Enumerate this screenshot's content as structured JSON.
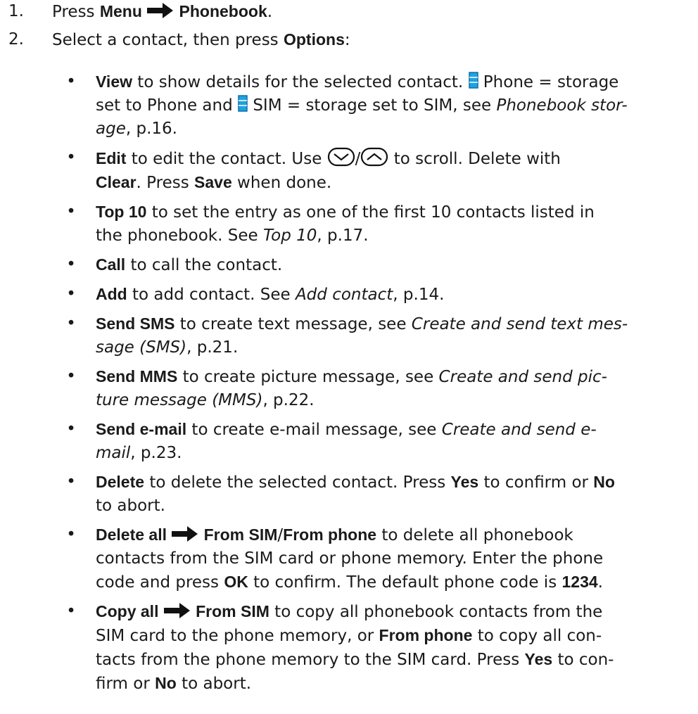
{
  "steps": [
    {
      "num": "1.",
      "t1": "Press ",
      "b1": "Menu",
      "b2": "Phonebook",
      "t2": "."
    },
    {
      "num": "2.",
      "t1": "Select a contact, then press ",
      "b1": "Options",
      "t2": ":"
    }
  ],
  "bullet_glyph": "•",
  "items": {
    "view": {
      "b1": "View",
      "t1": " to show details for the selected contact. ",
      "t2": " Phone = storage",
      "t3": "set to Phone and ",
      "t4": " SIM = storage set to SIM, see ",
      "i1": "Phonebook stor-",
      "i2": "age",
      "t5": ", p.16."
    },
    "edit": {
      "b1": "Edit",
      "t1": " to edit the contact. Use ",
      "t2": "/",
      "t3": " to scroll. Delete with",
      "b2": "Clear",
      "t4": ". Press ",
      "b3": "Save",
      "t5": " when done."
    },
    "top10": {
      "b1": "Top 10",
      "t1": " to set the entry as one of the first 10 contacts listed in",
      "t2": "the phonebook. See ",
      "i1": "Top 10",
      "t3": ", p.17."
    },
    "call": {
      "b1": "Call",
      "t1": " to call the contact."
    },
    "add": {
      "b1": "Add",
      "t1": " to add contact. See ",
      "i1": "Add contact",
      "t2": ", p.14."
    },
    "sms": {
      "b1": "Send SMS",
      "t1": " to create text message, see ",
      "i1": "Create and send text mes-",
      "i2": "sage (SMS)",
      "t2": ", p.21."
    },
    "mms": {
      "b1": "Send MMS",
      "t1": " to create picture message, see ",
      "i1": "Create and send pic-",
      "i2": "ture message (MMS)",
      "t2": ", p.22."
    },
    "email": {
      "b1": "Send e-mail",
      "t1": " to create e-mail message, see ",
      "i1": "Create and send e-",
      "i2": "mail",
      "t2": ", p.23."
    },
    "delete": {
      "b1": "Delete",
      "t1": " to delete the selected contact. Press ",
      "b2": "Yes",
      "t2": " to confirm or ",
      "b3": "No",
      "t3": "to abort."
    },
    "delete_all": {
      "b1": "Delete all",
      "b2": "From SIM",
      "t1": "/",
      "b3": "From phone",
      "t2": " to delete all phonebook",
      "t3": "contacts from the SIM card or phone memory. Enter the phone",
      "t4": "code and press ",
      "b4": "OK",
      "t5": " to confirm. The default phone code is ",
      "b5": "1234",
      "t6": "."
    },
    "copy_all": {
      "b1": "Copy all",
      "b2": "From SIM",
      "t1": " to copy all phonebook contacts from the",
      "t2": "SIM card to the phone memory, or ",
      "b3": "From phone",
      "t3": " to copy all con-",
      "t4": "tacts from the phone memory to the SIM card. Press ",
      "b4": "Yes",
      "t5": " to con-",
      "t6": "firm or ",
      "b5": "No",
      "t7": " to abort."
    }
  },
  "colors": {
    "text": "#1a1a1a",
    "storage_icon": "#1fa3e0",
    "storage_icon_stroke": "#0b6fa8"
  },
  "icons": {
    "arrow": "right-arrow-icon",
    "storage": "phonebook-storage-icon",
    "nav_down": "nav-key-down-icon",
    "nav_up": "nav-key-up-icon"
  }
}
